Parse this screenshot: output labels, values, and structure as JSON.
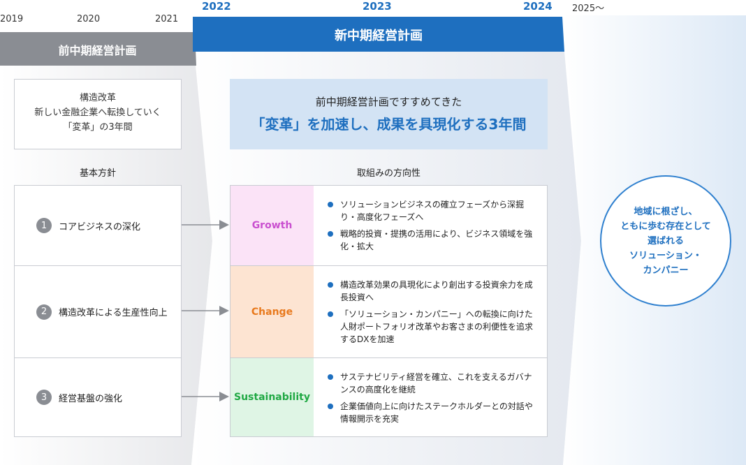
{
  "timeline": {
    "old_years": [
      "2019",
      "2020",
      "2021"
    ],
    "new_years": [
      "2022",
      "2023",
      "2024"
    ],
    "future_year": "2025～"
  },
  "old_plan": {
    "title": "前中期経営計画",
    "summary": [
      "構造改革",
      "新しい金融企業へ転換していく",
      "「変革」の3年間"
    ],
    "policy_title": "基本方針",
    "policies": [
      {
        "num": "1",
        "label": "コアビジネスの深化"
      },
      {
        "num": "2",
        "label": "構造改革による生産性向上"
      },
      {
        "num": "3",
        "label": "経営基盤の強化"
      }
    ]
  },
  "new_plan": {
    "title": "新中期経営計画",
    "summary_line1": "前中期経営計画ですすめてきた",
    "summary_line2": "「変革」を加速し、成果を具現化する3年間",
    "direction_title": "取組みの方向性",
    "directions": [
      {
        "label": "Growth",
        "color": "#c94fcf",
        "bg": "#fbe3f7",
        "items": [
          "ソリューションビジネスの確立フェーズから深掘り・高度化フェーズへ",
          "戦略的投資・提携の活用により、ビジネス領域を強化・拡大"
        ]
      },
      {
        "label": "Change",
        "color": "#e8791d",
        "bg": "#fde4d2",
        "items": [
          "構造改革効果の具現化により創出する投資余力を成長投資へ",
          "「ソリューション・カンパニー」への転換に向けた人財ポートフォリオ改革やお客さまの利便性を追求するDXを加速"
        ]
      },
      {
        "label": "Sustainability",
        "color": "#1fa843",
        "bg": "#dff5e5",
        "items": [
          "サステナビリティ経営を確立、これを支えるガバナンスの高度化を継続",
          "企業価値向上に向けたステークホルダーとの対話や情報開示を充実"
        ]
      }
    ]
  },
  "vision": {
    "lines": [
      "地域に根ざし、",
      "ともに歩む存在として",
      "選ばれる",
      "ソリューション・",
      "カンパニー"
    ]
  },
  "colors": {
    "old_bar": "#8a8d93",
    "new_bar": "#1e6fbf",
    "accent": "#1e6fbf"
  }
}
